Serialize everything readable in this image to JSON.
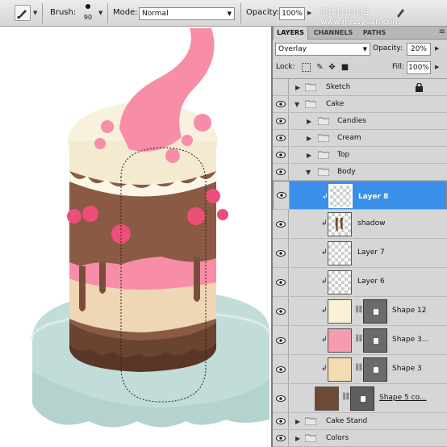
{
  "options_bar": {
    "brush_label": "Brush:",
    "brush_size": "90",
    "mode_label": "Mode:",
    "mode_value": "Normal",
    "opacity_label": "Opacity:",
    "opacity_value": "100%",
    "watermark": "思缘设计论坛 www.missyuan.com"
  },
  "panel": {
    "tabs": [
      "LAYERS",
      "CHANNELS",
      "PATHS"
    ],
    "blend_mode": "Overlay",
    "opacity_label": "Opacity:",
    "opacity_value": "20%",
    "lock_label": "Lock:",
    "fill_label": "Fill:",
    "fill_value": "100%"
  },
  "layers": [
    {
      "name": "Sketch",
      "kind": "group",
      "visible": false,
      "locked": true
    },
    {
      "name": "Cake",
      "kind": "group",
      "expanded": true,
      "visible": true
    },
    {
      "name": "Candies",
      "kind": "group",
      "visible": true
    },
    {
      "name": "Cream",
      "kind": "group",
      "visible": true
    },
    {
      "name": "Top",
      "kind": "group",
      "visible": true
    },
    {
      "name": "Body",
      "kind": "group",
      "expanded": true,
      "visible": true
    },
    {
      "name": "Layer 8",
      "kind": "layer",
      "selected": true,
      "clipped": true
    },
    {
      "name": "shadow",
      "kind": "layer",
      "clipped": true
    },
    {
      "name": "Layer 7",
      "kind": "layer",
      "clipped": true
    },
    {
      "name": "Layer 6",
      "kind": "layer",
      "clipped": true
    },
    {
      "name": "Shape 12",
      "kind": "shape",
      "clipped": true,
      "thumb_color": "#fbf1d6"
    },
    {
      "name": "Shape 3...",
      "kind": "shape",
      "clipped": true,
      "thumb_color": "#f69cb1"
    },
    {
      "name": "Shape 3",
      "kind": "shape",
      "clipped": true,
      "thumb_color": "#f3dcb2"
    },
    {
      "name": "Shape 5 co...",
      "kind": "shape",
      "thumb_color": "#6e4a34"
    },
    {
      "name": "Cake Stand",
      "kind": "group",
      "visible": true
    },
    {
      "name": "Colors",
      "kind": "group",
      "visible": true
    }
  ],
  "colors": {
    "selection": "#3a8fe8",
    "stand": "#bfdcd8",
    "chocolate": "#8a5a45",
    "cream": "#f7f1de",
    "pink": "#f78da6",
    "beige": "#efd7b6"
  }
}
